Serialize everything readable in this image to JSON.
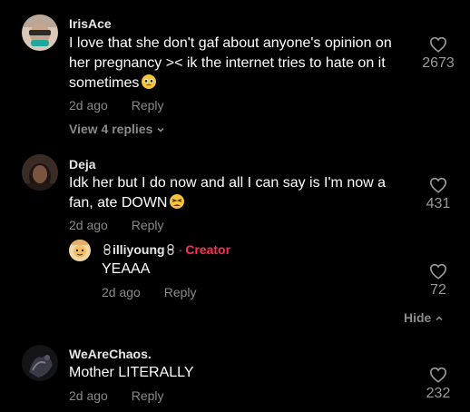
{
  "comments": [
    {
      "username": "IrisAce",
      "text_line1": "I love that she don't gaf about anyone's opinion on",
      "text_line2": "her pregnancy >< ik the internet tries to hate on it",
      "text_line3": "sometimes",
      "time": "2d ago",
      "reply_label": "Reply",
      "likes": "2673",
      "view_replies": "View 4 replies"
    },
    {
      "username": "Deja",
      "text_line1": "Idk her but I do now and all I can say is I'm now a",
      "text_line2": "fan, ate DOWN",
      "time": "2d ago",
      "reply_label": "Reply",
      "likes": "431",
      "reply": {
        "username": "illiyoung",
        "creator_label": "Creator",
        "text": "YEAAA",
        "time": "2d ago",
        "reply_label": "Reply",
        "likes": "72"
      },
      "hide_label": "Hide"
    },
    {
      "username": "WeAreChaos.",
      "text": "Mother LITERALLY",
      "time": "2d ago",
      "reply_label": "Reply",
      "likes": "232"
    }
  ],
  "colors": {
    "background": "#000000",
    "creator_accent": "#fe2c55",
    "secondary_text": "#8a8a8a"
  }
}
